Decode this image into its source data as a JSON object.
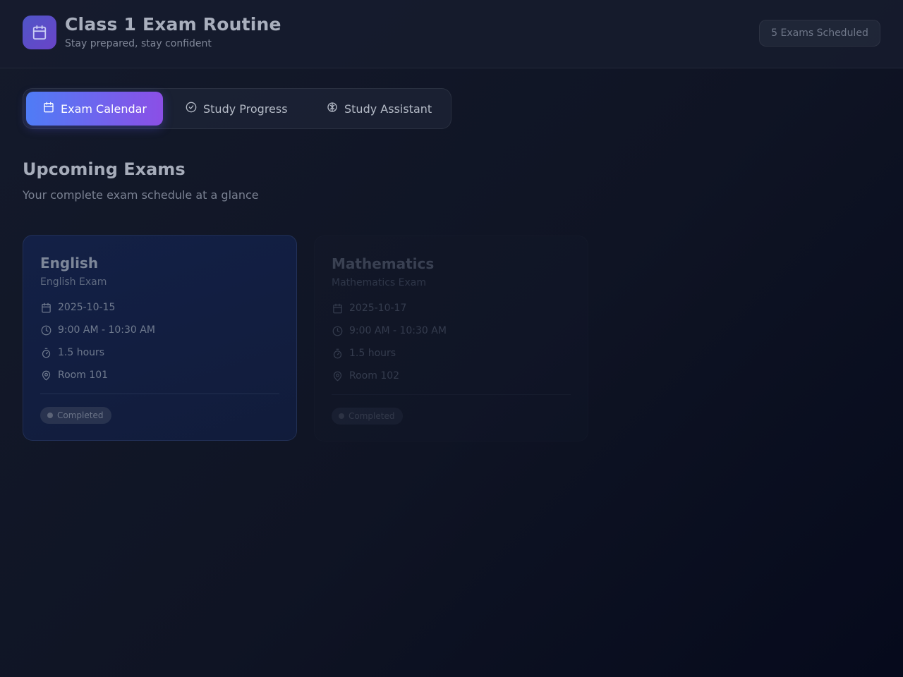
{
  "header": {
    "title": "Class 1 Exam Routine",
    "subtitle": "Stay prepared, stay confident",
    "logo_icon": "calendar-icon",
    "exams_badge": "5 Exams Scheduled"
  },
  "tabs": [
    {
      "label": "Exam Calendar",
      "icon": "calendar-icon",
      "active": true
    },
    {
      "label": "Study Progress",
      "icon": "check-circle-icon",
      "active": false
    },
    {
      "label": "Study Assistant",
      "icon": "brain-icon",
      "active": false
    }
  ],
  "main": {
    "title": "Upcoming Exams",
    "subtitle": "Your complete exam schedule at a glance"
  },
  "exams": [
    {
      "subject": "English",
      "name": "English Exam",
      "date": "2025-10-15",
      "time": "9:00 AM - 10:30 AM",
      "duration": "1.5 hours",
      "room": "Room 101",
      "status": "Completed"
    },
    {
      "subject": "Mathematics",
      "name": "Mathematics Exam",
      "date": "2025-10-17",
      "time": "9:00 AM - 10:30 AM",
      "duration": "1.5 hours",
      "room": "Room 102",
      "status": "Completed"
    }
  ],
  "colors": {
    "accent_start": "#4f7cf6",
    "accent_end": "#8b4fe6",
    "background": "#0f1424"
  }
}
